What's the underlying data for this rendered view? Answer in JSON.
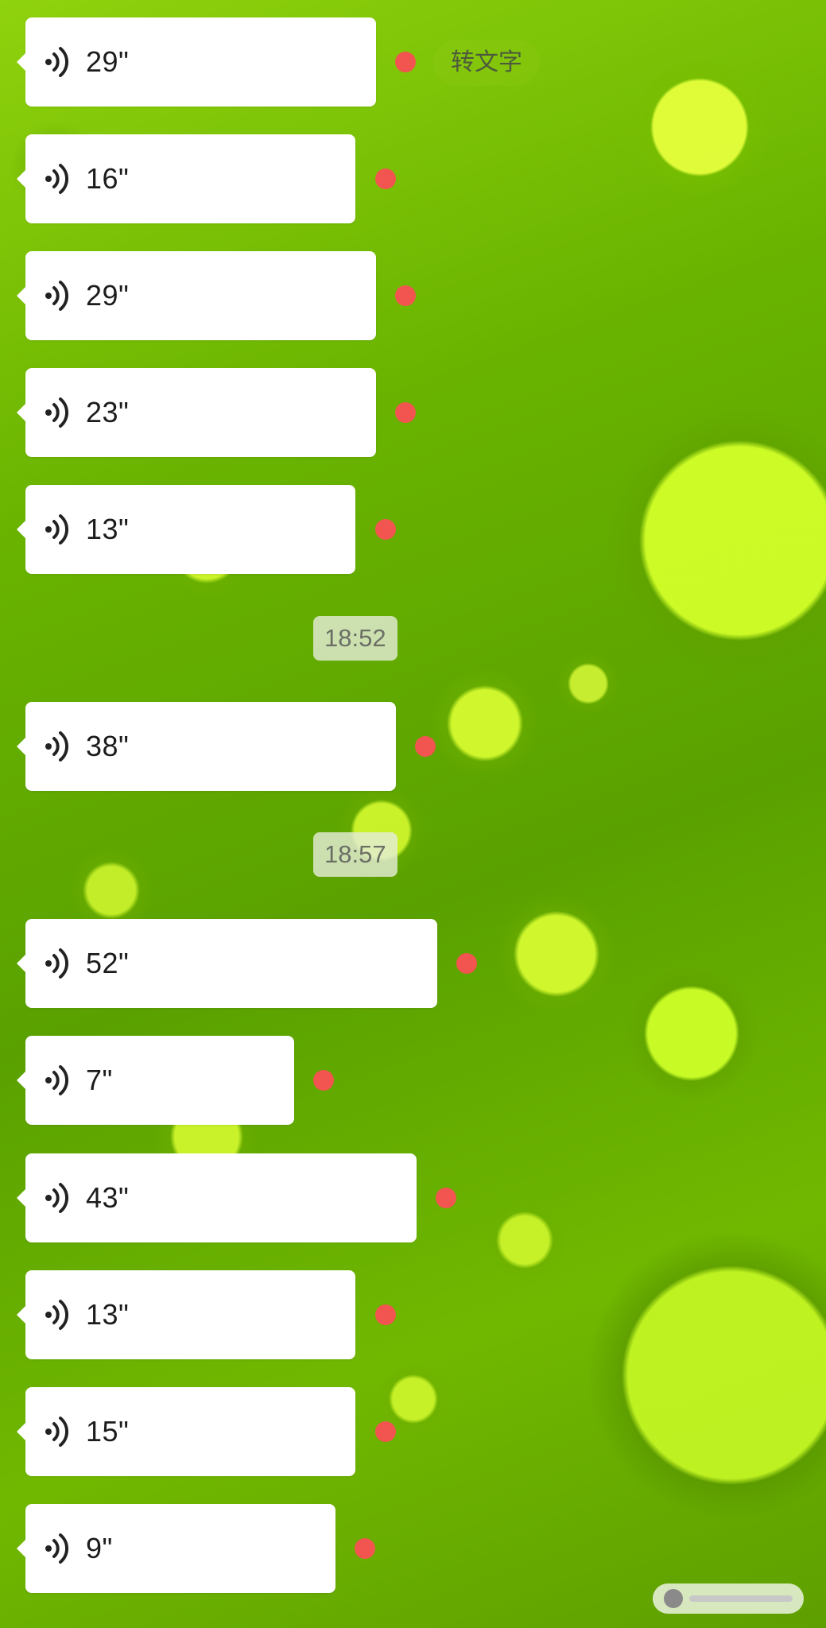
{
  "actions": {
    "transcribe_label": "转文字"
  },
  "messages": [
    {
      "duration": "29\""
    },
    {
      "duration": "16\""
    },
    {
      "duration": "29\""
    },
    {
      "duration": "23\""
    },
    {
      "duration": "13\""
    },
    {
      "timestamp": "18:52"
    },
    {
      "duration": "38\""
    },
    {
      "timestamp": "18:57"
    },
    {
      "duration": "52\""
    },
    {
      "duration": "7\""
    },
    {
      "duration": "43\""
    },
    {
      "duration": "13\""
    },
    {
      "duration": "15\""
    },
    {
      "duration": "9\""
    }
  ],
  "colors": {
    "bubble": "#ffffff",
    "unread_dot": "#f2554f",
    "background": "#6aaf00"
  },
  "icons": {
    "voice": "voice-message-icon",
    "watermark_logo": "watermark-logo"
  }
}
